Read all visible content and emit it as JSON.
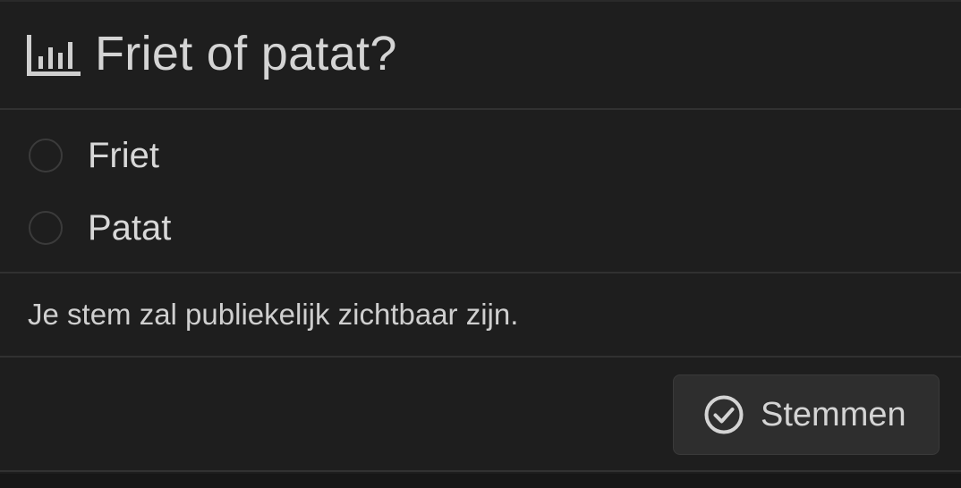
{
  "poll": {
    "icon": "bar-chart-icon",
    "title": "Friet of patat?",
    "options": [
      {
        "label": "Friet",
        "selected": false
      },
      {
        "label": "Patat",
        "selected": false
      }
    ],
    "notice": "Je stem zal publiekelijk zichtbaar zijn.",
    "vote_button": {
      "icon": "check-circle-icon",
      "label": "Stemmen"
    }
  },
  "colors": {
    "background": "#1e1e1e",
    "text": "#d6d6d6",
    "divider": "#313131",
    "button_background": "#2e2e2e",
    "radio_border": "#3b3b3b"
  }
}
